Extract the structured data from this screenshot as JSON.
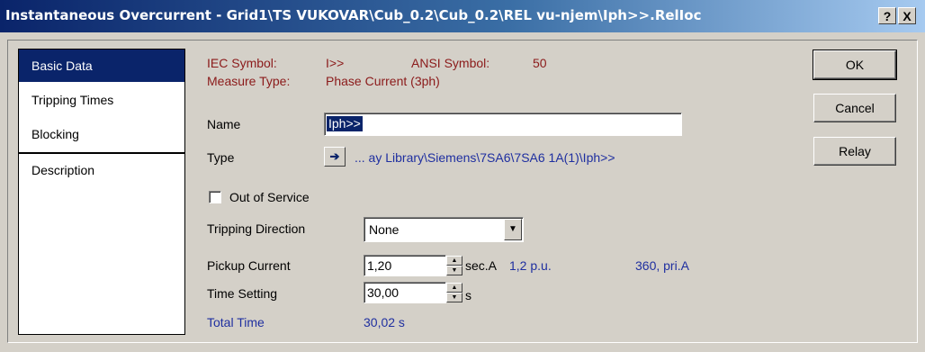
{
  "window": {
    "title": "Instantaneous Overcurrent - Grid1\\TS VUKOVAR\\Cub_0.2\\Cub_0.2\\REL vu-njem\\Iph>>.RelIoc",
    "help_label": "?",
    "close_label": "X"
  },
  "nav": {
    "items": [
      {
        "label": "Basic Data",
        "active": true
      },
      {
        "label": "Tripping Times"
      },
      {
        "label": "Blocking"
      },
      {
        "label": "Description"
      }
    ]
  },
  "header": {
    "iec_label": "IEC Symbol:",
    "iec_value": "I>>",
    "ansi_label": "ANSI Symbol:",
    "ansi_value": "50",
    "measure_label": "Measure Type:",
    "measure_value": "Phase Current (3ph)"
  },
  "form": {
    "name_label": "Name",
    "name_value": "Iph>>",
    "type_label": "Type",
    "type_value": "... ay Library\\Siemens\\7SA6\\7SA6 1A(1)\\Iph>>",
    "out_of_service_label": "Out of Service",
    "out_of_service_checked": false,
    "tripping_direction_label": "Tripping Direction",
    "tripping_direction_value": "None",
    "pickup_label": "Pickup Current",
    "pickup_value": "1,20",
    "pickup_unit": "sec.A",
    "pickup_pu": "1,2 p.u.",
    "pickup_pri": "360, pri.A",
    "time_label": "Time Setting",
    "time_value": "30,00",
    "time_unit": "s",
    "total_label": "Total Time",
    "total_value": "30,02 s"
  },
  "buttons": {
    "ok": "OK",
    "cancel": "Cancel",
    "relay": "Relay"
  },
  "colors": {
    "title_start": "#0a246a",
    "title_end": "#a6caf0",
    "label_red": "#8b1a1a",
    "value_blue": "#1f2fa0",
    "selection": "#0a246a"
  }
}
